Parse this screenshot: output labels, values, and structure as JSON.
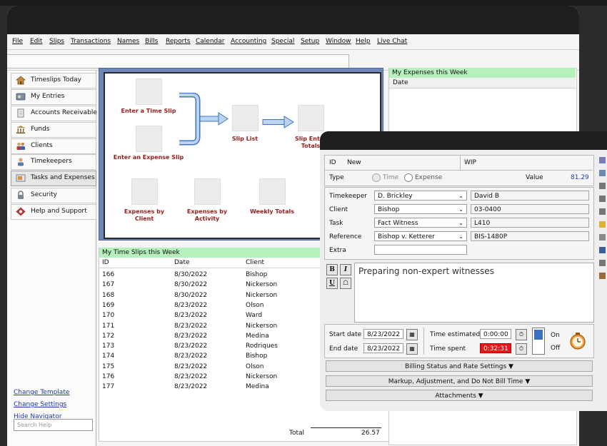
{
  "menu": [
    "File",
    "Edit",
    "Slips",
    "Transactions",
    "Names",
    "Bills",
    "Reports",
    "Calendar",
    "Accounting",
    "Special",
    "Setup",
    "Window",
    "Help",
    "Live Chat"
  ],
  "navigator": {
    "items": [
      {
        "label": "Timeslips Today",
        "icon": "house-icon"
      },
      {
        "label": "My Entries",
        "icon": "card-icon"
      },
      {
        "label": "Accounts Receivable",
        "icon": "document-icon"
      },
      {
        "label": "Funds",
        "icon": "bank-icon"
      },
      {
        "label": "Clients",
        "icon": "people-icon"
      },
      {
        "label": "Timekeepers",
        "icon": "person-icon"
      },
      {
        "label": "Tasks and Expenses",
        "icon": "tasks-icon"
      },
      {
        "label": "Security",
        "icon": "lock-icon"
      },
      {
        "label": "Help and Support",
        "icon": "help-icon"
      }
    ],
    "links": [
      "Change Template",
      "Change Settings",
      "Hide Navigator"
    ],
    "search_placeholder": "Search Help"
  },
  "flow": {
    "enter_time": "Enter a Time Slip",
    "enter_expense": "Enter an Expense Slip",
    "slip_list": "Slip List",
    "slip_entry_totals": "Slip Entry\nTotals",
    "exp_by_client": "Expenses by\nClient",
    "exp_by_activity": "Expenses by\nActivity",
    "weekly_totals": "Weekly Totals"
  },
  "time_slips": {
    "title": "My Time Slips this Week",
    "columns": [
      "ID",
      "Date",
      "Client"
    ],
    "rows": [
      [
        "166",
        "8/30/2022",
        "Bishop"
      ],
      [
        "167",
        "8/30/2022",
        "Nickerson"
      ],
      [
        "168",
        "8/30/2022",
        "Nickerson"
      ],
      [
        "169",
        "8/23/2022",
        "Olson"
      ],
      [
        "170",
        "8/23/2022",
        "Ward"
      ],
      [
        "171",
        "8/23/2022",
        "Nickerson"
      ],
      [
        "172",
        "8/23/2022",
        "Medina"
      ],
      [
        "173",
        "8/23/2022",
        "Rodriques"
      ],
      [
        "174",
        "8/23/2022",
        "Bishop"
      ],
      [
        "175",
        "8/23/2022",
        "Olson"
      ],
      [
        "176",
        "8/23/2022",
        "Nickerson"
      ],
      [
        "177",
        "8/23/2022",
        "Medina"
      ]
    ],
    "total_label": "Total",
    "total_value": "26.57"
  },
  "expenses": {
    "title": "My Expenses this Week",
    "column": "Date"
  },
  "slip": {
    "id_label": "ID",
    "id_value": "New",
    "wip_label": "WIP",
    "type_label": "Type",
    "type_options": [
      "Time",
      "Expense"
    ],
    "value_label": "Value",
    "value": "81.29",
    "timekeeper_label": "Timekeeper",
    "timekeeper": "D. Brickley",
    "timekeeper_full": "David B",
    "client_label": "Client",
    "client": "Bishop",
    "client_code": "03-0400",
    "task_label": "Task",
    "task": "Fact Witness",
    "task_code": "L410",
    "reference_label": "Reference",
    "reference": "Bishop v. Ketterer",
    "reference_code": "BIS-1480P",
    "extra_label": "Extra",
    "description": "Preparing non-expert witnesses",
    "start_label": "Start date",
    "start_date": "8/23/2022",
    "end_label": "End date",
    "end_date": "8/23/2022",
    "time_est_label": "Time estimated",
    "time_est": "0:00:00",
    "time_spent_label": "Time spent",
    "time_spent": "0:32:31",
    "on_label": "On",
    "off_label": "Off",
    "billing_bar": "Billing Status and Rate Settings  ▼",
    "markup_bar": "Markup, Adjustment, and Do Not Bill Time  ▼",
    "attach_bar": "Attachments ▼"
  },
  "colors": {
    "accent_green": "#b6f0bc",
    "flow_label": "#9a1c1c",
    "link": "#1a3aa8",
    "timer_red": "#e8151a",
    "value_blue": "#1a3aa8"
  }
}
